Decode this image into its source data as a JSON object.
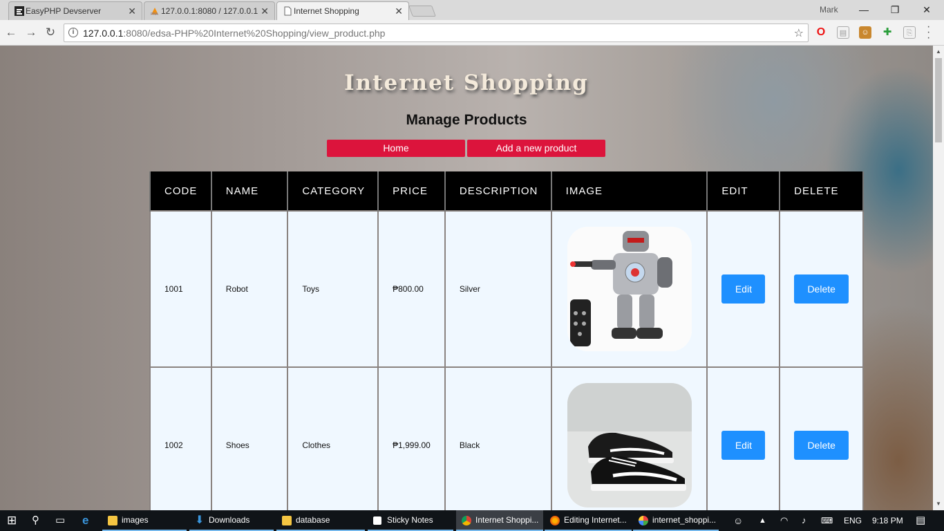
{
  "browser": {
    "tabs": [
      {
        "title": "EasyPHP Devserver",
        "active": false
      },
      {
        "title": "127.0.0.1:8080 / 127.0.0.1",
        "active": false
      },
      {
        "title": "Internet Shopping",
        "active": true
      }
    ],
    "user": "Mark",
    "url_host": "127.0.0.1",
    "url_rest": ":8080/edsa-PHP%20Internet%20Shopping/view_product.php"
  },
  "page": {
    "site_title": "Internet Shopping",
    "heading": "Manage Products",
    "nav": {
      "home": "Home",
      "add": "Add a new product"
    },
    "columns": [
      "CODE",
      "NAME",
      "CATEGORY",
      "PRICE",
      "DESCRIPTION",
      "IMAGE",
      "EDIT",
      "DELETE"
    ],
    "products": [
      {
        "code": "1001",
        "name": "Robot",
        "category": "Toys",
        "price": "₱800.00",
        "description": "Silver",
        "image": "robot-toy",
        "edit": "Edit",
        "delete": "Delete"
      },
      {
        "code": "1002",
        "name": "Shoes",
        "category": "Clothes",
        "price": "₱1,999.00",
        "description": "Black",
        "image": "sneakers",
        "edit": "Edit",
        "delete": "Delete"
      }
    ]
  },
  "taskbar": {
    "items": [
      "images",
      "Downloads",
      "database",
      "Sticky Notes",
      "Internet Shoppi...",
      "Editing Internet...",
      "internet_shoppi..."
    ],
    "language": "ENG",
    "time": "9:18 PM"
  },
  "colors": {
    "accent_red": "#dc143c",
    "button_blue": "#1e90ff",
    "table_header": "#000000",
    "row_bg": "#f0f8ff"
  }
}
